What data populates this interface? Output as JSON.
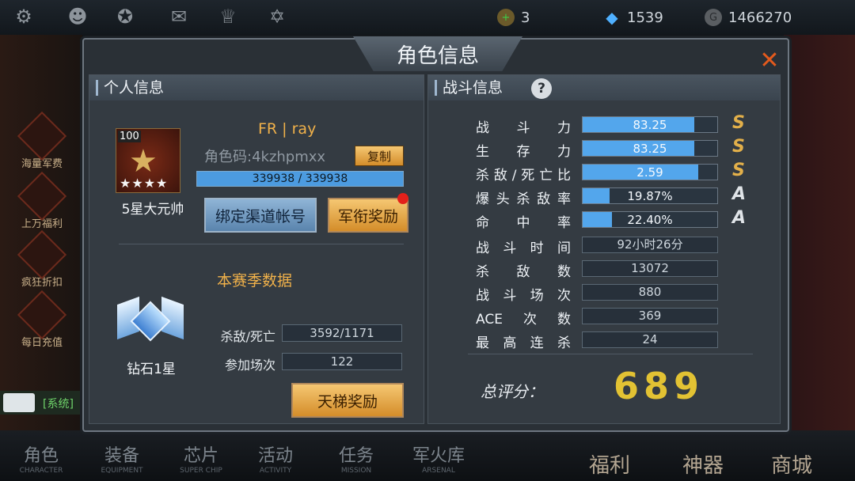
{
  "topbar": {
    "icons": [
      "gear-icon",
      "group-icon",
      "rank-wings-icon",
      "mail-icon",
      "trophy-icon",
      "star-badge-icon"
    ],
    "resources": [
      {
        "name": "coin-plus-icon",
        "value": "3",
        "color": "#c9a44a"
      },
      {
        "name": "diamond-icon",
        "value": "1539",
        "color": "#4fb0ff"
      },
      {
        "name": "gold-coin-icon",
        "value": "1466270",
        "color": "#8b8f94"
      }
    ]
  },
  "sidebar": {
    "items": [
      "海量军费",
      "",
      "上万福利",
      "疯狂折扣",
      "每日充值"
    ]
  },
  "chat": {
    "text": "[系统]"
  },
  "dialog": {
    "title": "角色信息",
    "close_icon": "close-icon",
    "left": {
      "header": "个人信息",
      "rank_level": "100",
      "rank_stars": "★★★★",
      "rank_title": "5星大元帅",
      "player_name": "FR | ray",
      "role_code": "角色码:4kzhpmxx",
      "copy_label": "复制",
      "exp_text": "339938 / 339938",
      "exp_fraction": 1.0,
      "bind_label": "绑定渠道帐号",
      "rank_reward_label": "军衔奖励",
      "season_title": "本赛季数据",
      "season_badge_title": "钻石1星",
      "kd_label": "杀敌/死亡",
      "kd_value": "3592/1171",
      "matches_label": "参加场次",
      "matches_value": "122",
      "ladder_reward_label": "天梯奖励"
    },
    "right": {
      "header": "战斗信息",
      "help_icon": "?",
      "bar_stats": [
        {
          "label": "战斗力",
          "value": "83.25",
          "fraction": 0.83,
          "grade": "S"
        },
        {
          "label": "生存力",
          "value": "83.25",
          "fraction": 0.83,
          "grade": "S"
        },
        {
          "label": "杀敌/死亡比",
          "value": "2.59",
          "fraction": 0.86,
          "grade": "S"
        },
        {
          "label": "爆头杀敌率",
          "value": "19.87%",
          "fraction": 0.2,
          "grade": "A"
        },
        {
          "label": "命中率",
          "value": "22.40%",
          "fraction": 0.22,
          "grade": "A"
        }
      ],
      "box_stats": [
        {
          "label": "战斗时间",
          "value": "92小时26分"
        },
        {
          "label": "杀敌数",
          "value": "13072"
        },
        {
          "label": "战斗场次",
          "value": "880"
        },
        {
          "label": "ACE次数",
          "value": "369"
        },
        {
          "label": "最高连杀",
          "value": "24"
        }
      ],
      "total_label": "总评分：",
      "total_value": "689"
    }
  },
  "bottom_nav": [
    {
      "cn": "角色",
      "en": "CHARACTER"
    },
    {
      "cn": "装备",
      "en": "EQUIPMENT"
    },
    {
      "cn": "芯片",
      "en": "SUPER CHIP"
    },
    {
      "cn": "活动",
      "en": "ACTIVITY"
    },
    {
      "cn": "任务",
      "en": "MISSION"
    },
    {
      "cn": "军火库",
      "en": "ARSENAL"
    }
  ],
  "bottom_big": [
    "福利",
    "神器",
    "商城"
  ],
  "colors": {
    "grade_S": "#e3b04a",
    "grade_A": "#e0e4e8",
    "accent": "#f0b14a"
  }
}
